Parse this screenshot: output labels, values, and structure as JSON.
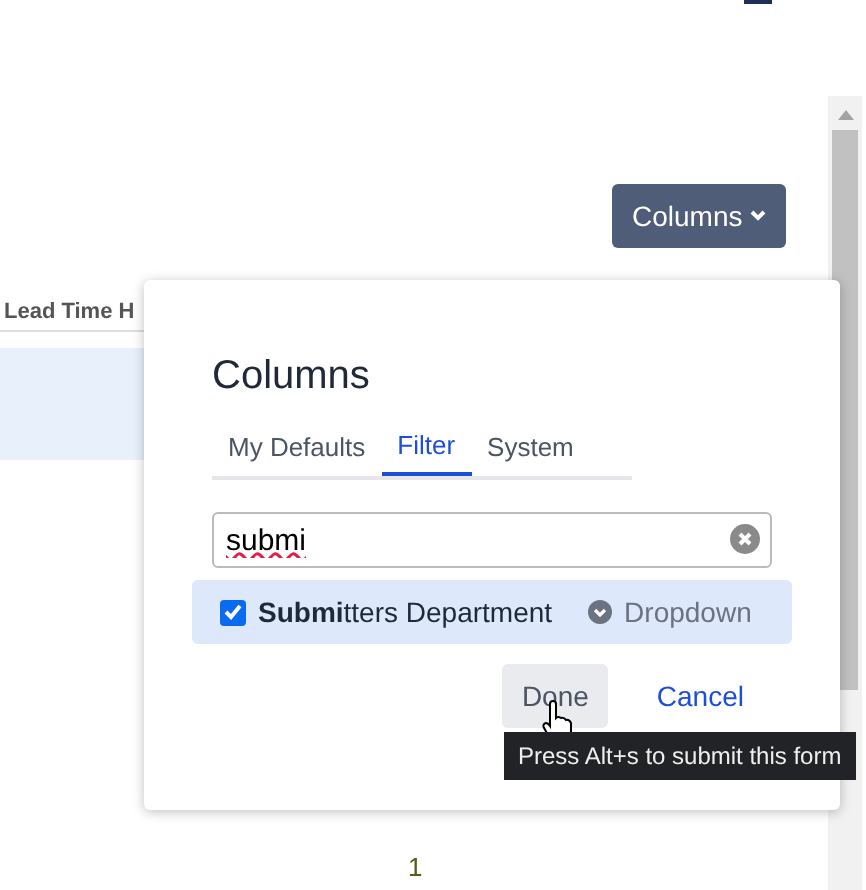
{
  "toolbar": {
    "columns_button": "Columns"
  },
  "table": {
    "columns": [
      "Lead Time H"
    ]
  },
  "popup": {
    "title": "Columns",
    "tabs": [
      {
        "label": "My Defaults",
        "selected": false
      },
      {
        "label": "Filter",
        "selected": true
      },
      {
        "label": "System",
        "selected": false
      }
    ],
    "search": {
      "value": "submi"
    },
    "results": [
      {
        "label": "**Submi**tters Department",
        "checked": true,
        "type": "Dropdown"
      }
    ],
    "buttons": [
      "Done",
      "Cancel"
    ],
    "tooltip": "Press Alt+s to submit this form"
  },
  "pagination": {
    "page": "1"
  }
}
